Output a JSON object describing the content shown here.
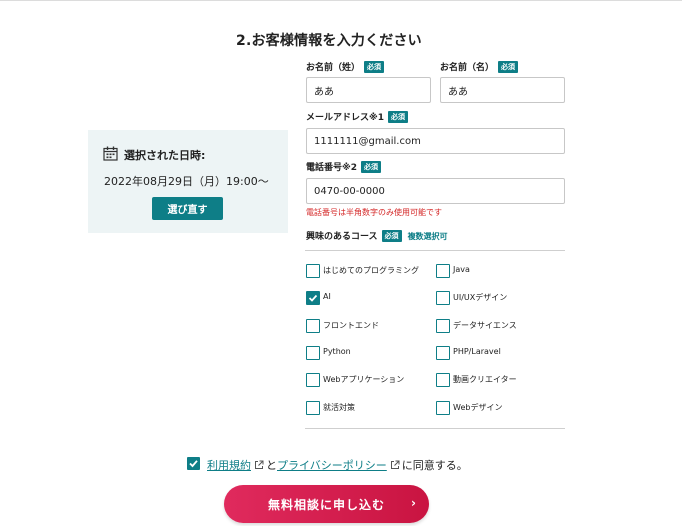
{
  "form": {
    "title": "2.お客様情報を入力ください",
    "required_badge": "必須",
    "fields": {
      "last_name": {
        "label": "お名前（姓）",
        "value": "ああ"
      },
      "first_name": {
        "label": "お名前（名）",
        "value": "ああ"
      },
      "email": {
        "label": "メールアドレス※1",
        "value": "1111111@gmail.com"
      },
      "phone": {
        "label": "電話番号※2",
        "value": "0470-00-0000",
        "error": "電話番号は半角数字のみ使用可能です"
      }
    },
    "courses": {
      "label": "興味のあるコース",
      "multi_note": "複数選択可",
      "items": [
        {
          "label": "はじめてのプログラミング",
          "checked": false
        },
        {
          "label": "Java",
          "checked": false
        },
        {
          "label": "AI",
          "checked": true
        },
        {
          "label": "UI/UXデザイン",
          "checked": false
        },
        {
          "label": "フロントエンド",
          "checked": false
        },
        {
          "label": "データサイエンス",
          "checked": false
        },
        {
          "label": "Python",
          "checked": false
        },
        {
          "label": "PHP/Laravel",
          "checked": false
        },
        {
          "label": "Webアプリケーション",
          "checked": false
        },
        {
          "label": "動画クリエイター",
          "checked": false
        },
        {
          "label": "就活対策",
          "checked": false
        },
        {
          "label": "Webデザイン",
          "checked": false
        }
      ]
    },
    "agreement": {
      "checked": true,
      "terms_link": "利用規約",
      "connector": "と",
      "privacy_link": "プライバシーポリシー",
      "suffix": "に同意する。"
    },
    "submit_label": "無料相談に申し込む",
    "submit_chevron": "›"
  },
  "schedule": {
    "label": "選択された日時:",
    "value": "2022年08月29日（月）19:00〜",
    "reselect_label": "選び直す"
  },
  "colors": {
    "accent": "#0e7e87",
    "panel_bg": "#edf4f5",
    "error": "#d42626",
    "submit": "#d61d4e"
  }
}
